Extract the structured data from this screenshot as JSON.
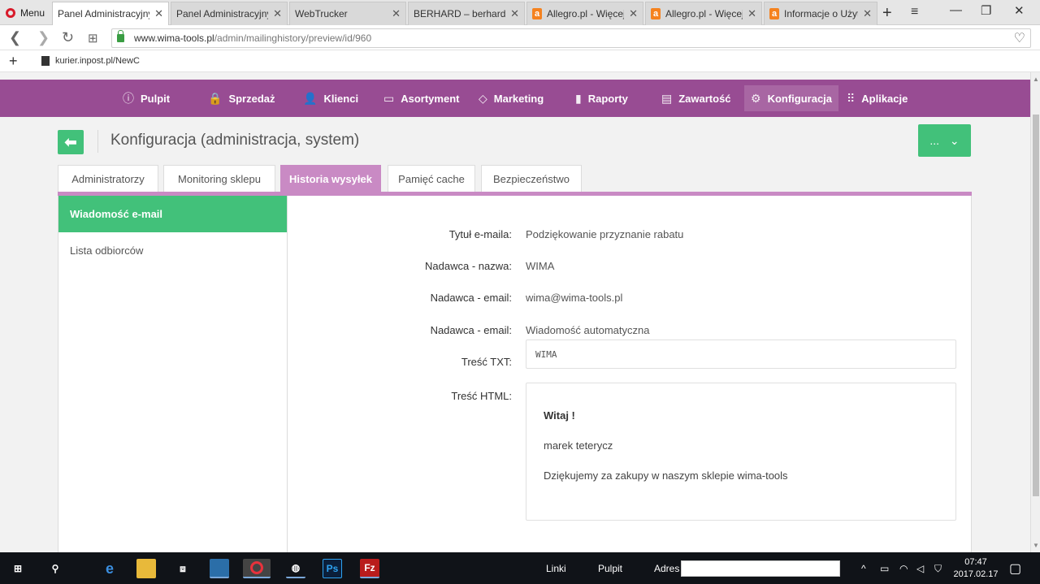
{
  "browser": {
    "menu_label": "Menu",
    "tabs": [
      {
        "label": "Panel Administracyjny",
        "icon": "page-icon",
        "active": true
      },
      {
        "label": "Panel Administracyjny",
        "icon": "page-icon",
        "active": false
      },
      {
        "label": "WebTrucker",
        "icon": "page-icon",
        "active": false
      },
      {
        "label": "BERHARD – berhard",
        "icon": "page-icon",
        "active": false
      },
      {
        "label": "Allegro.pl - Więcej",
        "icon": "allegro-icon",
        "active": false
      },
      {
        "label": "Allegro.pl - Więcej",
        "icon": "allegro-icon",
        "active": false
      },
      {
        "label": "Informacje o Użytkowniku",
        "icon": "allegro-icon",
        "active": false
      }
    ],
    "url_host": "www.wima-tools.pl",
    "url_path": "/admin/mailinghistory/preview/id/960",
    "bookmark": "kurier.inpost.pl/NewC"
  },
  "mainnav": {
    "items": [
      {
        "label": "Pulpit",
        "icon": "ⓘ"
      },
      {
        "label": "Sprzedaż",
        "icon": "🔒"
      },
      {
        "label": "Klienci",
        "icon": "👤"
      },
      {
        "label": "Asortyment",
        "icon": "▭"
      },
      {
        "label": "Marketing",
        "icon": "◇"
      },
      {
        "label": "Raporty",
        "icon": "▮"
      },
      {
        "label": "Zawartość",
        "icon": "▤"
      },
      {
        "label": "Konfiguracja",
        "icon": "⚙"
      },
      {
        "label": "Aplikacje",
        "icon": "⠿"
      }
    ],
    "active": "Konfiguracja"
  },
  "header": {
    "title": "Konfiguracja (administracja, system)",
    "more_label": "..."
  },
  "tabs": [
    {
      "label": "Administratorzy",
      "active": false
    },
    {
      "label": "Monitoring sklepu",
      "active": false
    },
    {
      "label": "Historia wysyłek",
      "active": true
    },
    {
      "label": "Pamięć cache",
      "active": false
    },
    {
      "label": "Bezpieczeństwo",
      "active": false
    }
  ],
  "sidebar": {
    "items": [
      {
        "label": "Wiadomość e-mail",
        "active": true
      },
      {
        "label": "Lista odbiorców",
        "active": false
      }
    ]
  },
  "email": {
    "subject_label": "Tytuł e-maila:",
    "subject": "Podziękowanie przyznanie rabatu",
    "sender_name_label": "Nadawca - nazwa:",
    "sender_name": "WIMA",
    "sender_email_label": "Nadawca - email:",
    "sender_email": "wima@wima-tools.pl",
    "sender_email2_label": "Nadawca - email:",
    "sender_email2": "Wiadomość automatyczna",
    "txt_label": "Treść TXT:",
    "txt": "WIMA",
    "html_label": "Treść HTML:",
    "html_greeting": "Witaj !",
    "html_name": "marek teterycz",
    "html_message": "Dziękujemy za zakupy w naszym sklepie wima-tools"
  },
  "taskbar": {
    "links_label": "Linki",
    "pulpit_label": "Pulpit",
    "address_label": "Adres",
    "time": "07:47",
    "date": "2017.02.17"
  },
  "colors": {
    "nav_purple": "#984c93",
    "tab_active": "#c98ac4",
    "accent_green": "#42c17a"
  }
}
